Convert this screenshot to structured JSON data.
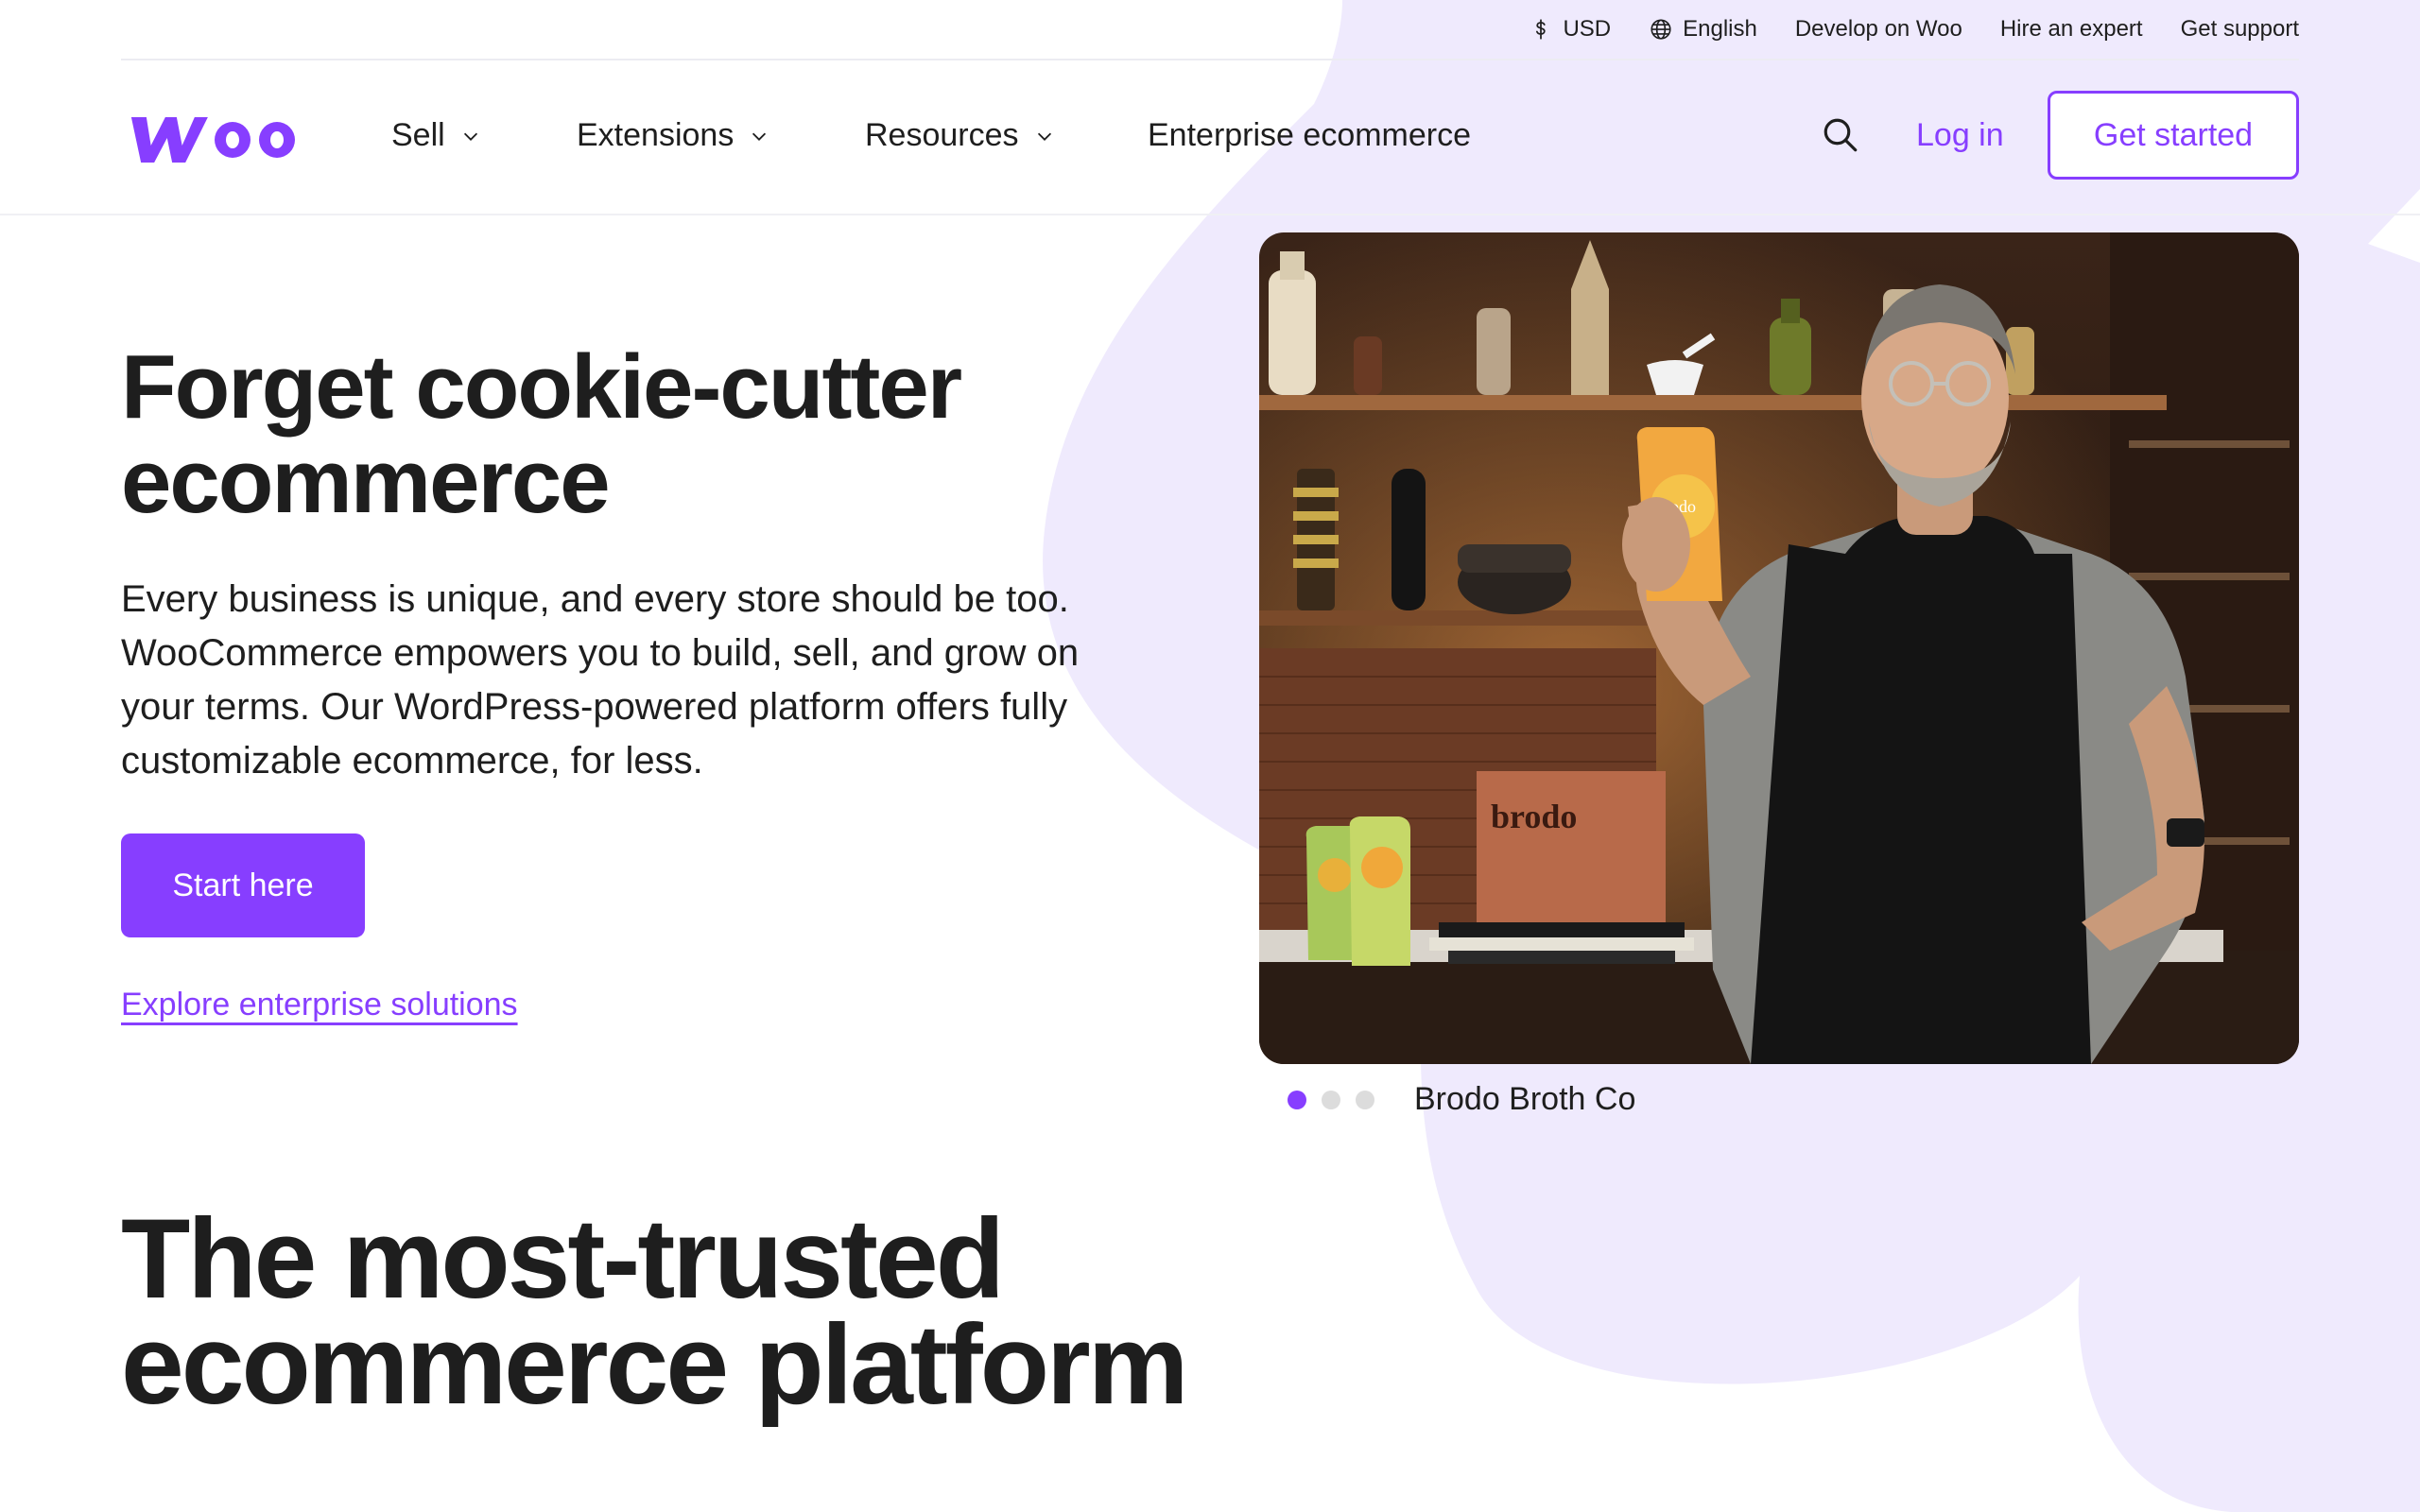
{
  "colors": {
    "brand": "#873eff",
    "lavender": "#efeafd",
    "text": "#1e1e1e"
  },
  "utility_bar": {
    "currency": {
      "icon": "dollar-icon",
      "label": "USD"
    },
    "language": {
      "icon": "globe-icon",
      "label": "English"
    },
    "links": [
      "Develop on Woo",
      "Hire an expert",
      "Get support"
    ]
  },
  "nav": {
    "logo_text": "woo",
    "items": [
      {
        "label": "Sell",
        "has_dropdown": true
      },
      {
        "label": "Extensions",
        "has_dropdown": true
      },
      {
        "label": "Resources",
        "has_dropdown": true
      },
      {
        "label": "Enterprise ecommerce",
        "has_dropdown": false
      }
    ],
    "search_icon": "search-icon",
    "login_label": "Log in",
    "get_started_label": "Get started"
  },
  "hero": {
    "title": "Forget cookie-cutter ecommerce",
    "description": "Every business is unique, and every store should be too. WooCommerce empowers you to build, sell, and grow on your terms. Our WordPress-powered platform offers fully customizable ecommerce, for less.",
    "primary_cta": "Start here",
    "secondary_link": "Explore enterprise solutions",
    "carousel": {
      "active_index": 0,
      "total": 3,
      "caption": "Brodo Broth Co"
    },
    "photo_text": {
      "pouch_label": "brodo",
      "book_title": "brodo"
    }
  },
  "section": {
    "title": "The most-trusted ecommerce platform"
  }
}
